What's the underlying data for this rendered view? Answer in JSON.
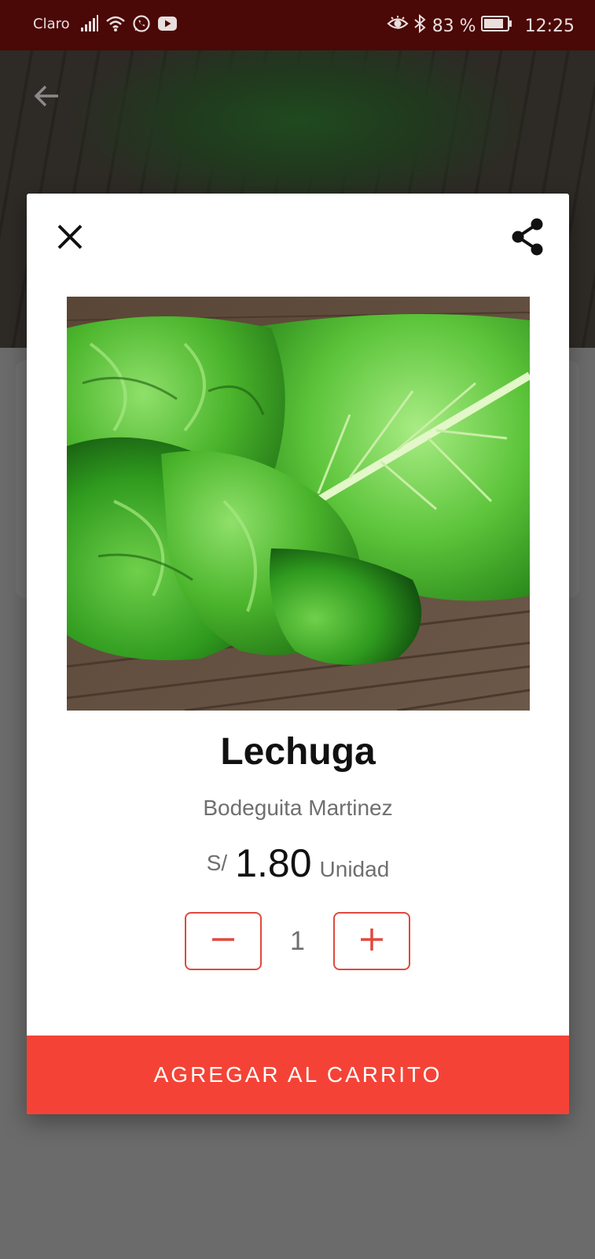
{
  "status_bar": {
    "carrier": "Claro",
    "battery": "83 %",
    "time": "12:25",
    "icons": [
      "signal-icon",
      "wifi-icon",
      "whatsapp-icon",
      "youtube-icon",
      "eye-icon",
      "bluetooth-icon",
      "battery-icon"
    ]
  },
  "background": {
    "back_icon": "arrow-left-icon"
  },
  "dialog": {
    "close_icon": "close-icon",
    "share_icon": "share-icon",
    "image_subject": "lettuce-image",
    "product_name": "Lechuga",
    "store": "Bodeguita Martinez",
    "price": {
      "currency": "S/",
      "amount": "1.80",
      "unit": "Unidad"
    },
    "quantity": "1",
    "add_to_cart": "AGREGAR AL CARRITO"
  },
  "colors": {
    "status_bar": "#4a0806",
    "accent": "#f44336",
    "stepper_border": "#e0493e",
    "overlay": "#6b6b6b"
  }
}
